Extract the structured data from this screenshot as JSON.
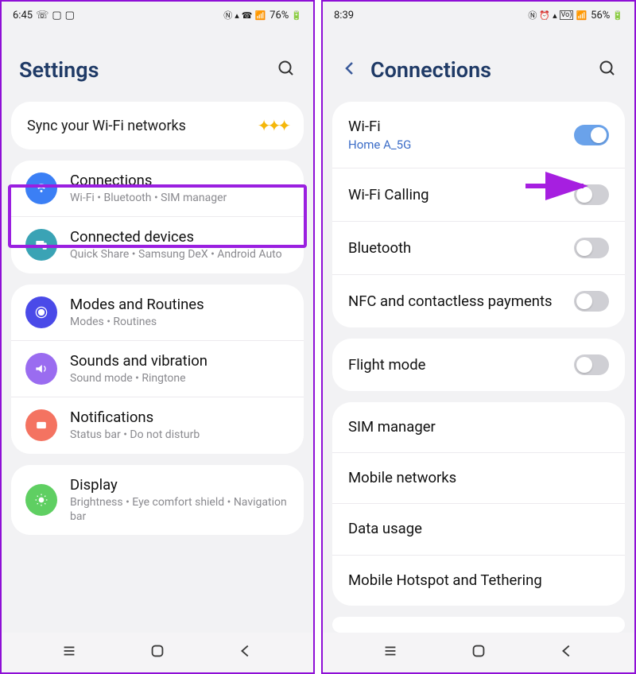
{
  "left": {
    "status": {
      "time": "6:45",
      "battery": "76%"
    },
    "title": "Settings",
    "sync": "Sync your Wi-Fi networks",
    "groups": [
      [
        {
          "title": "Connections",
          "sub": "Wi-Fi  •  Bluetooth  •  SIM manager"
        },
        {
          "title": "Connected devices",
          "sub": "Quick Share  •  Samsung DeX  •  Android Auto"
        }
      ],
      [
        {
          "title": "Modes and Routines",
          "sub": "Modes  •  Routines"
        },
        {
          "title": "Sounds and vibration",
          "sub": "Sound mode  •  Ringtone"
        },
        {
          "title": "Notifications",
          "sub": "Status bar  •  Do not disturb"
        }
      ],
      [
        {
          "title": "Display",
          "sub": "Brightness  •  Eye comfort shield  •  Navigation bar"
        }
      ]
    ]
  },
  "right": {
    "status": {
      "time": "8:39",
      "battery": "56%"
    },
    "title": "Connections",
    "groups": [
      [
        {
          "title": "Wi-Fi",
          "sub": "Home A_5G",
          "toggle": "on"
        },
        {
          "title": "Wi-Fi Calling",
          "toggle": "off"
        },
        {
          "title": "Bluetooth",
          "toggle": "off"
        },
        {
          "title": "NFC and contactless payments",
          "toggle": "off"
        }
      ],
      [
        {
          "title": "Flight mode",
          "toggle": "off"
        }
      ],
      [
        {
          "title": "SIM manager"
        },
        {
          "title": "Mobile networks"
        },
        {
          "title": "Data usage"
        },
        {
          "title": "Mobile Hotspot and Tethering"
        }
      ]
    ]
  }
}
